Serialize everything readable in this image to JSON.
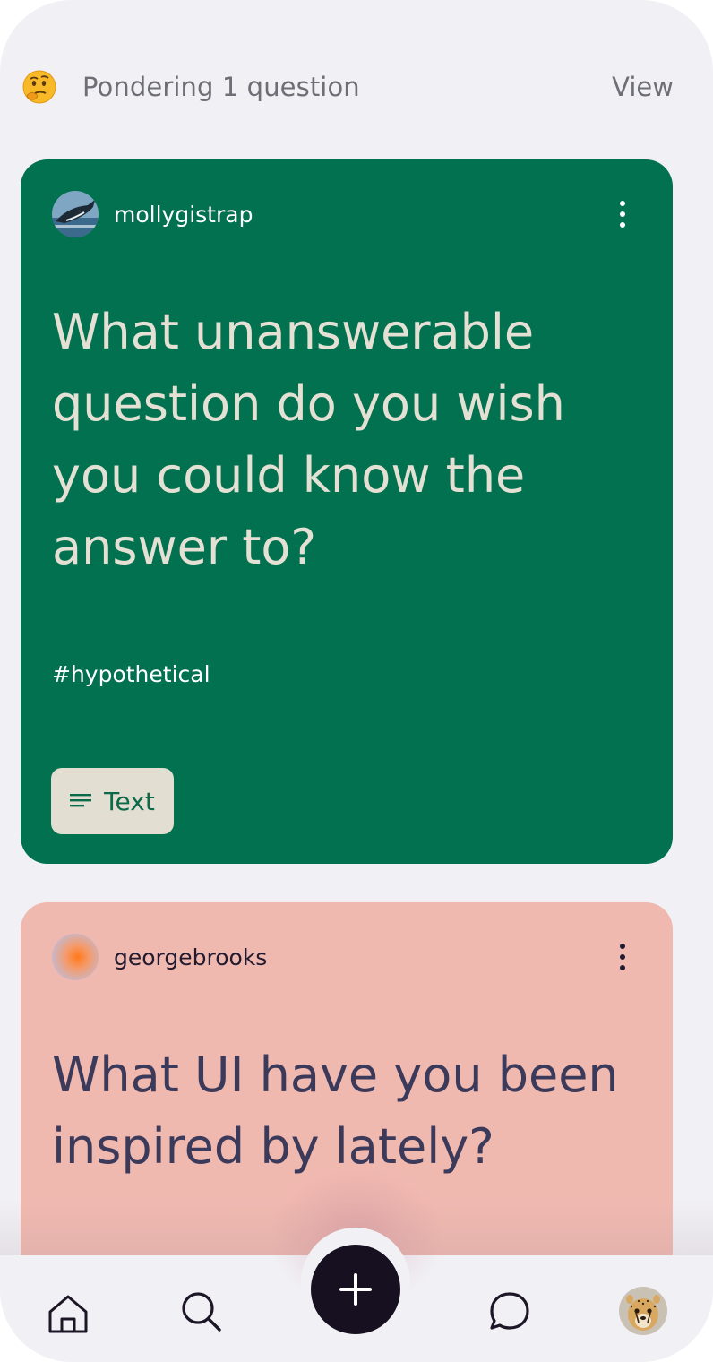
{
  "status": {
    "emoji": "thinking-face-icon",
    "text": "Pondering 1 question",
    "view_label": "View"
  },
  "cards": [
    {
      "username": "mollygistrap",
      "avatar": "whale-photo",
      "question": "What unanswerable question do you wish you could know the answer to?",
      "hashtag": "#hypothetical",
      "type_label": "Text",
      "background": "#017150",
      "text_color": "#e4e0d4"
    },
    {
      "username": "georgebrooks",
      "avatar": "gradient-orb",
      "question": "What UI have you been inspired by lately?",
      "background": "#f0b9b0",
      "text_color": "#3c3a5a"
    }
  ],
  "nav": {
    "items": [
      "home-icon",
      "search-icon",
      "plus-icon",
      "chat-icon",
      "profile-avatar"
    ],
    "fab_color": "#171020"
  }
}
